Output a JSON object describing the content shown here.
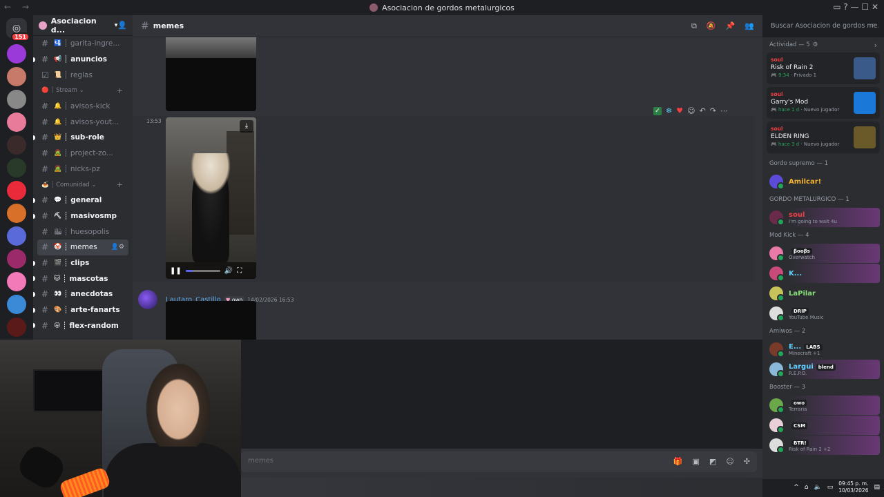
{
  "window": {
    "title": "Asociacion de gordos metalurgicos",
    "nav_arrows": "← →",
    "controls": "▭ ? — ☐ ✕"
  },
  "home_badge": "151",
  "server": {
    "name": "Asociacion d...",
    "channels": [
      {
        "name": "garita-ingre...",
        "emoji": "🛂",
        "state": "muted"
      },
      {
        "name": "anuncios",
        "emoji": "📢",
        "state": "unread"
      },
      {
        "name": "reglas",
        "emoji": "📜",
        "state": "muted",
        "rules": true
      },
      {
        "category": "Stream",
        "emoji": "🔴"
      },
      {
        "name": "avisos-kick",
        "emoji": "🔔",
        "state": "muted"
      },
      {
        "name": "avisos-yout...",
        "emoji": "🔔",
        "state": "muted"
      },
      {
        "name": "sub-role",
        "emoji": "👑",
        "state": "unread"
      },
      {
        "name": "project-zo...",
        "emoji": "🧟",
        "state": "muted"
      },
      {
        "name": "nicks-pz",
        "emoji": "🧟",
        "state": "muted"
      },
      {
        "category": "Comunidad",
        "emoji": "🍝"
      },
      {
        "name": "general",
        "emoji": "💬",
        "state": "unread"
      },
      {
        "name": "masivosmp",
        "emoji": "⛏",
        "state": "unread"
      },
      {
        "name": "huesopolis",
        "emoji": "🏙",
        "state": "muted"
      },
      {
        "name": "memes",
        "emoji": "🤡",
        "state": "active"
      },
      {
        "name": "clips",
        "emoji": "🎬",
        "state": "unread"
      },
      {
        "name": "mascotas",
        "emoji": "🐱",
        "state": "unread"
      },
      {
        "name": "anecdotas",
        "emoji": "👀",
        "state": "unread"
      },
      {
        "name": "arte-fanarts",
        "emoji": "🎨",
        "state": "unread"
      },
      {
        "name": "flex-random",
        "emoji": "😛",
        "state": "unread"
      }
    ]
  },
  "chat": {
    "channel_name": "memes",
    "search_placeholder": "Buscar Asociacion de gordos me...",
    "message_time": "13:53",
    "video_progress": 0.2,
    "second_author": "Lautaro_Castillo",
    "second_tag": "owo",
    "second_time": "14/02/2026 16:53",
    "composer_placeholder": "memes"
  },
  "members": {
    "activity_header": "Actividad — 5",
    "activities": [
      {
        "user": "soul",
        "game": "Risk of Rain 2",
        "meta_green": "9:34",
        "meta": "Privado 1",
        "color": "#3a5a8a"
      },
      {
        "user": "soul",
        "game": "Garry's Mod",
        "meta_green": "hace 1 d",
        "meta": "Nuevo jugador",
        "color": "#1a78d8"
      },
      {
        "user": "soul",
        "game": "ELDEN RING",
        "meta_green": "hace 3 d",
        "meta": "Nuevo jugador",
        "color": "#6a5a2a"
      }
    ],
    "groups": [
      {
        "header": "Gordo supremo — 1",
        "members": [
          {
            "name": "Amilcar!",
            "color": "#f0b232",
            "status": "",
            "badge": "",
            "avatar": "#5c4bd8",
            "banner": false
          }
        ]
      },
      {
        "header": "GORDO METALURGICO — 1",
        "members": [
          {
            "name": "soul",
            "color": "#f23f43",
            "status": "I'm going to wait 4u",
            "badge": "",
            "avatar": "#6a2a4a",
            "banner": true
          }
        ]
      },
      {
        "header": "Mod Kick — 4",
        "members": [
          {
            "name": "",
            "color": "#f2f3f5",
            "status": "Overwatch",
            "badge": "βοοβs",
            "avatar": "#e87aa8",
            "banner": true
          },
          {
            "name": "K...",
            "color": "#5fd0ff",
            "status": "",
            "badge": "",
            "avatar": "#c84a7a",
            "banner": true
          },
          {
            "name": "LaPilar",
            "color": "#8ae07a",
            "status": "",
            "badge": "",
            "avatar": "#c8c25a",
            "banner": false
          },
          {
            "name": "",
            "color": "#4a3ad8",
            "status": "YouTube Music",
            "badge": "DRIP",
            "avatar": "#ddd",
            "banner": false
          }
        ]
      },
      {
        "header": "Amiwos — 2",
        "members": [
          {
            "name": "E...",
            "color": "#5fd0ff",
            "status": "Minecraft +1",
            "badge": "LABS",
            "avatar": "#7a3a2a",
            "banner": false
          },
          {
            "name": "Largui",
            "color": "#5fd0ff",
            "status": "R.E.P.O.",
            "badge": "blend",
            "avatar": "#8ab8d8",
            "banner": true
          }
        ]
      },
      {
        "header": "Booster — 3",
        "members": [
          {
            "name": "",
            "color": "#d84ad8",
            "status": "Terraria",
            "badge": "owo",
            "avatar": "#6aa84a",
            "banner": true
          },
          {
            "name": "",
            "color": "#8a2ad8",
            "status": "",
            "badge": "CSM",
            "avatar": "#e8d0d8",
            "banner": true
          },
          {
            "name": "",
            "color": "#4a3ad8",
            "status": "Risk of Rain 2 +2",
            "badge": "BTR!",
            "avatar": "#ddd",
            "banner": true
          }
        ]
      }
    ]
  },
  "clock": {
    "time": "09:45 p. m.",
    "date": "10/03/2026"
  }
}
